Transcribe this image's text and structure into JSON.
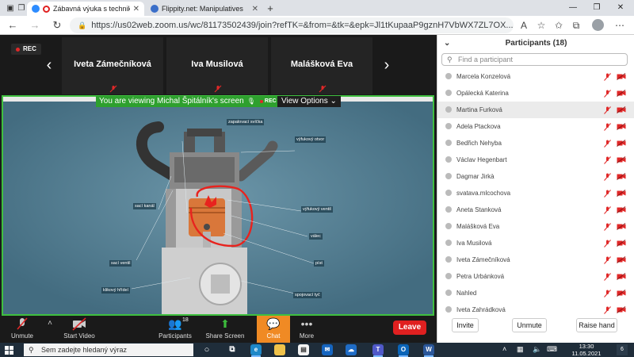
{
  "browser": {
    "tabs": [
      {
        "title": "Zábavná výuka s technikou",
        "active": true
      },
      {
        "title": "Flippity.net: Manipulatives",
        "active": false
      }
    ],
    "url": "https://us02web.zoom.us/wc/81173502439/join?refTK=&from=&tk=&epk=Jl1tKupaaP9gznH7VbWX7ZL7OX..."
  },
  "zoom": {
    "rec": "REC",
    "tiles": [
      "Iveta Zámečníková",
      "Iva Musilová",
      "Malášková Eva"
    ],
    "viewing_banner": "You are viewing Michal Špitálník's screen",
    "banner_rec": "REC",
    "view_options": "View Options",
    "engine_labels": {
      "zapalovaci_svicka": "zapalovací svíčka",
      "vyfukovy_otvor": "výfukový otvor",
      "saci_kanal": "sací kanál",
      "vyfukovy_ventil": "výfukový ventil",
      "valec": "válec",
      "saci_ventil": "sací ventil",
      "pist": "píst",
      "klikovy_hridel": "klikový hřídel",
      "spojovaci_tyc": "spojovací tyč"
    },
    "toolbar": {
      "unmute": "Unmute",
      "start_video": "Start Video",
      "participants": "Participants",
      "participants_count": "18",
      "share_screen": "Share Screen",
      "chat": "Chat",
      "more": "More",
      "leave": "Leave"
    }
  },
  "participants_panel": {
    "title": "Participants (18)",
    "search_placeholder": "Find a participant",
    "list": [
      "Marcela Konzelová",
      "Opálecká Katerina",
      "Martina Furková",
      "Adela Ptackova",
      "Bedřich Nehyba",
      "Václav Hegenbart",
      "Dagmar Jirkà",
      "svatava.mlcochova",
      "Aneta Stanková",
      "Malášková Eva",
      "Iva Musilová",
      "Iveta Zámečníková",
      "Petra Urbánková",
      "Nahled",
      "Iveta Zahrádková"
    ],
    "buttons": {
      "invite": "Invite",
      "unmute": "Unmute",
      "raise_hand": "Raise hand"
    }
  },
  "taskbar": {
    "search_placeholder": "Sem zadejte hledaný výraz",
    "time": "13:30",
    "date": "11.05.2021",
    "notifications": "6"
  },
  "colors": {
    "accent_green": "#2ea02e",
    "leave_red": "#e02020",
    "chat_orange": "#f08a24",
    "share_bg": "#4e7a8e"
  }
}
